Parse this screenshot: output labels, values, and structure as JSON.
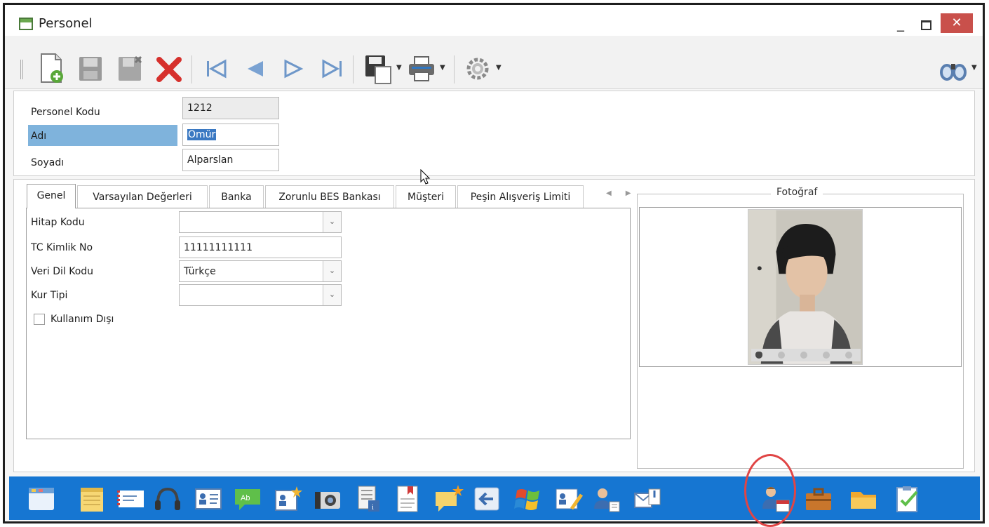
{
  "window": {
    "title": "Personel",
    "controls": {
      "minimize": "_",
      "maximize": "□",
      "close": "✕"
    }
  },
  "toolbar": {
    "buttons": [
      {
        "name": "new-record-icon"
      },
      {
        "name": "save-icon"
      },
      {
        "name": "save-and-close-icon"
      },
      {
        "name": "delete-icon"
      },
      {
        "name": "first-record-icon"
      },
      {
        "name": "previous-record-icon"
      },
      {
        "name": "next-record-icon"
      },
      {
        "name": "last-record-icon"
      },
      {
        "name": "export-icon"
      },
      {
        "name": "print-icon"
      },
      {
        "name": "settings-gear-icon"
      },
      {
        "name": "search-binoculars-icon"
      }
    ]
  },
  "header": {
    "personel_kodu_label": "Personel Kodu",
    "personel_kodu_value": "1212",
    "adi_label": "Adı",
    "adi_value": "Ömür",
    "soyadi_label": "Soyadı",
    "soyadi_value": "Alparslan"
  },
  "tabs": [
    {
      "label": "Genel",
      "active": true
    },
    {
      "label": "Varsayılan Değerleri"
    },
    {
      "label": "Banka"
    },
    {
      "label": "Zorunlu BES Bankası"
    },
    {
      "label": "Müşteri"
    },
    {
      "label": "Peşin Alışveriş Limiti"
    }
  ],
  "genel": {
    "hitap_kodu_label": "Hitap Kodu",
    "hitap_kodu_value": "",
    "tc_kimlik_label": "TC Kimlik No",
    "tc_kimlik_value": "11111111111",
    "veri_dil_label": "Veri Dil Kodu",
    "veri_dil_value": "Türkçe",
    "kur_tipi_label": "Kur Tipi",
    "kur_tipi_value": "",
    "kullanim_disi_label": "Kullanım Dışı",
    "kullanim_disi_checked": false
  },
  "photo": {
    "caption": "Fotoğraf"
  },
  "bottom_bar": {
    "color": "#1676d2",
    "icons": [
      "calendar-icon",
      "notepad-icon",
      "mail-icon",
      "headset-icon",
      "contact-card-icon",
      "chat-bubble-icon",
      "new-contact-icon",
      "camera-icon",
      "document-info-icon",
      "bookmark-document-icon",
      "new-message-icon",
      "back-arrow-icon",
      "windows-logo-icon",
      "edit-contact-icon",
      "user-list-icon",
      "mailbox-icon",
      "user-calendar-icon",
      "briefcase-icon",
      "folder-icon",
      "clipboard-check-icon"
    ],
    "highlighted": "user-calendar-icon"
  }
}
